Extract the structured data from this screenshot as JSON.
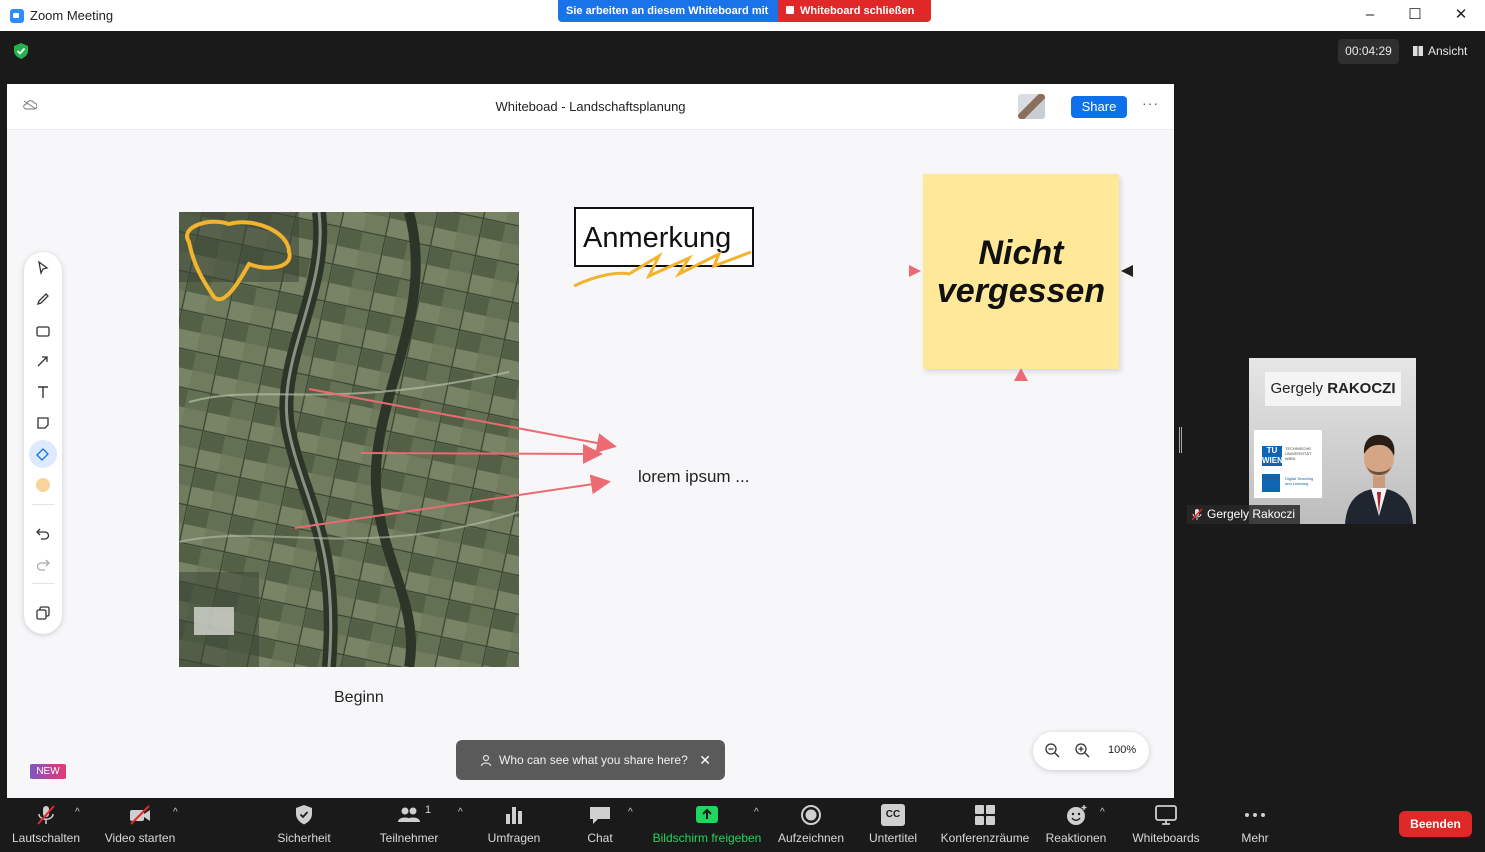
{
  "window": {
    "title": "Zoom Meeting",
    "minimize": "–",
    "maximize": "☐",
    "close": "✕"
  },
  "banner": {
    "info": "Sie arbeiten an diesem Whiteboard mit",
    "close_label": "Whiteboard schließen"
  },
  "meeting_header": {
    "timer": "00:04:29",
    "view_label": "Ansicht"
  },
  "whiteboard": {
    "title": "Whiteboad - Landschaftsplanung",
    "share_label": "Share",
    "more_label": "···",
    "annotation_box": "Anmerkung",
    "sticky_note": "Nicht vergessen",
    "free_text": "lorem ipsum ...",
    "image_caption": "Beginn",
    "toast": "Who can see what you share here?",
    "toast_close": "✕",
    "new_badge": "NEW",
    "zoom_level": "100%",
    "tools": [
      "select",
      "pen",
      "shape",
      "connector",
      "text",
      "sticky-note",
      "eraser",
      "color",
      "undo",
      "redo",
      "templates"
    ],
    "active_tool": "eraser",
    "colors": {
      "highlight": "#f4b32f",
      "arrow": "#ec6a72",
      "sticky": "#ffe999",
      "accent": "#0e71eb"
    }
  },
  "participant": {
    "name_label": "Gergely Rakoczi",
    "tile_first": "Gergely ",
    "tile_last": "RAKOCZI",
    "logo_tu": "TU",
    "logo_tu_sub": "WIEN",
    "logo_text": "TECHNISCHE UNIVERSITÄT WIEN",
    "logo_dt": "Digital Teaching and Learning"
  },
  "controls": {
    "mute": "Lautschalten",
    "video": "Video starten",
    "security": "Sicherheit",
    "participants": "Teilnehmer",
    "participants_count": "1",
    "polls": "Umfragen",
    "chat": "Chat",
    "share_screen": "Bildschirm freigeben",
    "record": "Aufzeichnen",
    "captions": "Untertitel",
    "breakout": "Konferenzräume",
    "reactions": "Reaktionen",
    "whiteboards": "Whiteboards",
    "more": "Mehr",
    "end": "Beenden",
    "captions_icon_text": "CC"
  }
}
